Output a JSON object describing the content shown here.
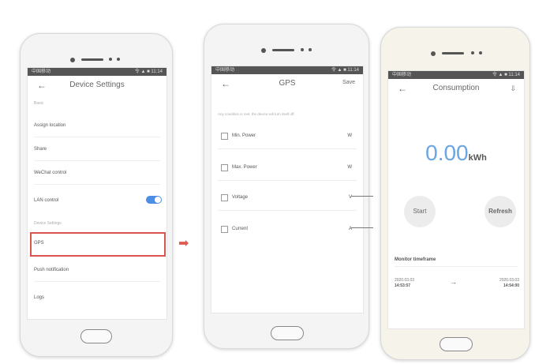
{
  "screen1": {
    "status_left": "中国移动",
    "status_right": "令 ▲ ■ 11:14",
    "title": "Device Settings",
    "section_top": "Basic",
    "items": [
      {
        "label": "Assign location"
      },
      {
        "label": "Share"
      },
      {
        "label": "WeChat control"
      },
      {
        "label": "LAN control"
      }
    ],
    "section_device": "Device Settings",
    "gps_label": "GPS",
    "push_label": "Push notification",
    "logs_label": "Logs"
  },
  "screen2": {
    "status_left": "中国移动",
    "status_right": "令 ▲ ■ 11:14",
    "title": "GPS",
    "save_label": "Save",
    "hint": "Any condition is met, the device will turn itself off.",
    "items": [
      {
        "label": "Min. Power",
        "unit": "W"
      },
      {
        "label": "Max. Power",
        "unit": "W"
      },
      {
        "label": "Voltage",
        "unit": "V"
      },
      {
        "label": "Current",
        "unit": "A"
      }
    ]
  },
  "screen3": {
    "status_left": "中国移动",
    "status_right": "令 ▲ ■ 11:14",
    "title": "Consumption",
    "value": "0.00",
    "unit": "kWh",
    "start_label": "Start",
    "refresh_label": "Refresh",
    "monitor_label": "Monitor timeframe",
    "from_date": "2020.03.03",
    "from_time": "14:53:57",
    "to_date": "2020.03.03",
    "to_time": "14:54:00",
    "arrow": "→"
  },
  "colors": {
    "accent": "#4c8ee6",
    "highlight": "#d9534f",
    "value": "#6aa6e3",
    "transition_arrow": "#e05a50"
  }
}
